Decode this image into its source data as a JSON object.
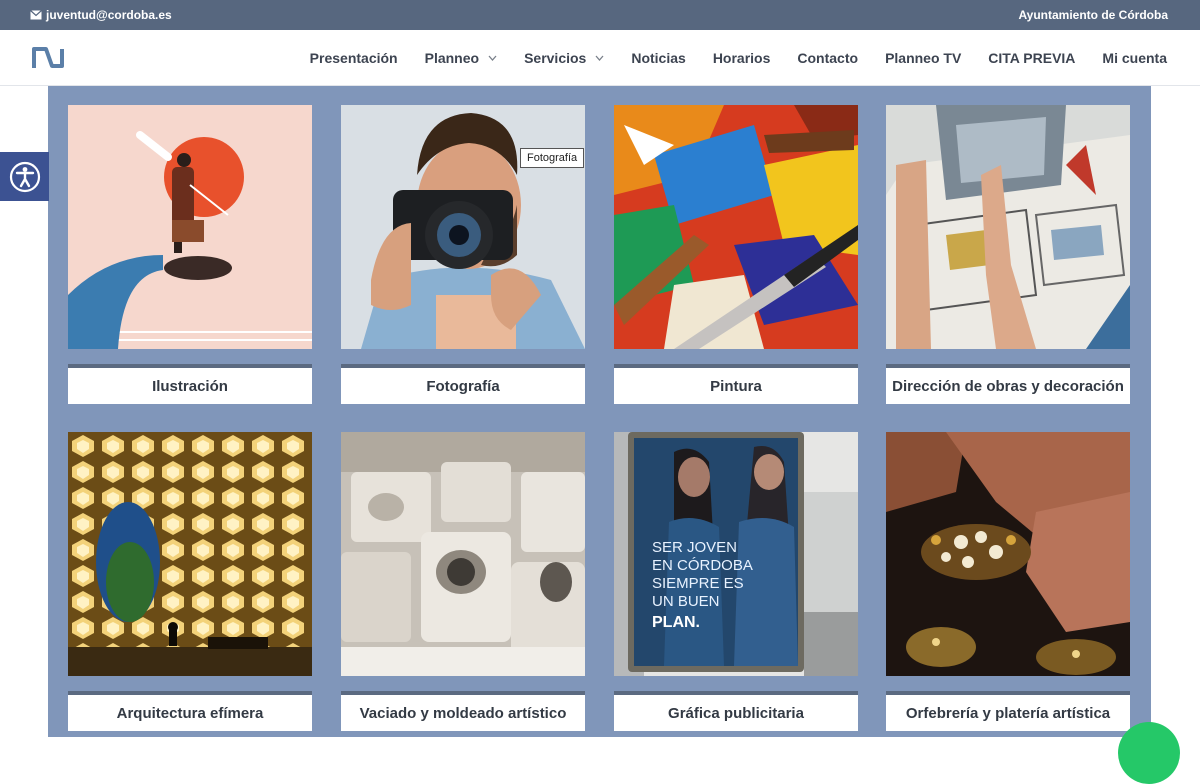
{
  "topbar": {
    "email": "juventud@cordoba.es",
    "city": "Ayuntamiento de Córdoba"
  },
  "header": {
    "logo": "planneo-logo-icon",
    "nav": [
      {
        "label": "Presentación",
        "dropdown": false
      },
      {
        "label": "Planneo",
        "dropdown": true
      },
      {
        "label": "Servicios",
        "dropdown": true
      },
      {
        "label": "Noticias",
        "dropdown": false
      },
      {
        "label": "Horarios",
        "dropdown": false
      },
      {
        "label": "Contacto",
        "dropdown": false
      },
      {
        "label": "Planneo TV",
        "dropdown": false
      },
      {
        "label": "CITA PREVIA",
        "dropdown": false
      },
      {
        "label": "Mi cuenta",
        "dropdown": false
      }
    ]
  },
  "tooltip": "Fotografía",
  "tiles": [
    {
      "caption": "Ilustración",
      "icon": "illustration-image"
    },
    {
      "caption": "Fotografía",
      "icon": "photography-image"
    },
    {
      "caption": "Pintura",
      "icon": "painting-image"
    },
    {
      "caption": "Dirección de obras y decoración",
      "icon": "architecture-plans-image"
    },
    {
      "caption": "Arquitectura efímera",
      "icon": "ephemeral-architecture-image"
    },
    {
      "caption": "Vaciado y moldeado artístico",
      "icon": "molds-image"
    },
    {
      "caption": "Gráfica publicitaria",
      "icon": "advertising-poster-image"
    },
    {
      "caption": "Orfebrería y platería artística",
      "icon": "jewelry-image"
    }
  ],
  "poster_text": [
    "SER JOVEN",
    "EN CÓRDOBA",
    "SIEMPRE ES",
    "UN BUEN",
    "PLAN."
  ],
  "colors": {
    "topbar": "#57677f",
    "panel": "#8096ba",
    "accessibility": "#3c5292",
    "chat": "#25c868"
  }
}
